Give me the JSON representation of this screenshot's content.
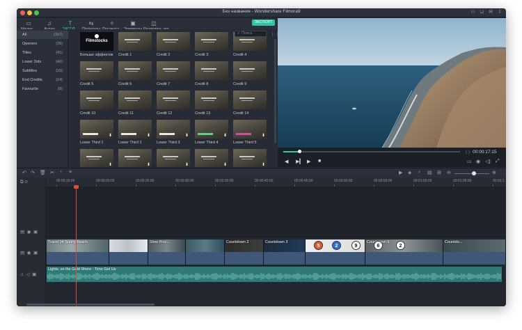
{
  "window": {
    "title": "Без названия - Wondershare Filmora9"
  },
  "title_icons": [
    "person-icon",
    "cart-icon",
    "mail-icon",
    "download-icon"
  ],
  "tabs": [
    {
      "name": "media",
      "label": "Медиа...",
      "icon": "folder-icon",
      "glyph": "▭",
      "active": false
    },
    {
      "name": "audio",
      "label": "Аудио",
      "icon": "music-note-icon",
      "glyph": "♫",
      "active": false
    },
    {
      "name": "titles",
      "label": "ЗАГОЛ...",
      "icon": "text-t-icon",
      "glyph": "T",
      "active": true
    },
    {
      "name": "transitions",
      "label": "Переходы",
      "icon": "transition-icon",
      "glyph": "⇆",
      "active": false
    },
    {
      "name": "effects",
      "label": "Последст...",
      "icon": "effects-icon",
      "glyph": "✧",
      "active": false
    },
    {
      "name": "elements",
      "label": "Элементы",
      "icon": "image-icon",
      "glyph": "▣",
      "active": false
    },
    {
      "name": "split",
      "label": "Разделить экр...",
      "icon": "split-screen-icon",
      "glyph": "◫",
      "active": false
    }
  ],
  "export_label": "ЭКСПОРТ",
  "search": {
    "placeholder": "Поиск"
  },
  "categories": [
    {
      "name": "All",
      "count": "(157)",
      "active": true
    },
    {
      "name": "Openers",
      "count": "(25)",
      "active": false
    },
    {
      "name": "Titles",
      "count": "(41)",
      "active": false
    },
    {
      "name": "Lower 3rds",
      "count": "(42)",
      "active": false
    },
    {
      "name": "Subtitles",
      "count": "(15)",
      "active": false
    },
    {
      "name": "End Credits",
      "count": "(14)",
      "active": false
    },
    {
      "name": "Favourite",
      "count": "(0)",
      "active": false
    }
  ],
  "library_items": [
    {
      "label": "Больше эффектов",
      "type": "brand",
      "brand": "Filmstocks"
    },
    {
      "label": "Credit 1",
      "type": "credit"
    },
    {
      "label": "Credit 2",
      "type": "credit"
    },
    {
      "label": "Credit 3",
      "type": "credit"
    },
    {
      "label": "Credit 4",
      "type": "credit"
    },
    {
      "label": "Credit 5",
      "type": "credit"
    },
    {
      "label": "Credit 6",
      "type": "credit"
    },
    {
      "label": "Credit 7",
      "type": "credit"
    },
    {
      "label": "Credit 8",
      "type": "credit"
    },
    {
      "label": "Credit 9",
      "type": "credit"
    },
    {
      "label": "Credit 10",
      "type": "credit"
    },
    {
      "label": "Credit 11",
      "type": "credit"
    },
    {
      "label": "Credit 12",
      "type": "credit"
    },
    {
      "label": "Credit 13",
      "type": "credit"
    },
    {
      "label": "Credit 14",
      "type": "credit"
    },
    {
      "label": "Lower Third 1",
      "type": "lower"
    },
    {
      "label": "Lower Third 2",
      "type": "lower"
    },
    {
      "label": "Lower Third 3",
      "type": "lower"
    },
    {
      "label": "Lower Third 4",
      "type": "lower"
    },
    {
      "label": "Lower Third 5",
      "type": "lower"
    },
    {
      "label": "",
      "type": "partial"
    },
    {
      "label": "",
      "type": "partial"
    },
    {
      "label": "",
      "type": "partial"
    },
    {
      "label": "",
      "type": "partial"
    },
    {
      "label": "",
      "type": "partial"
    }
  ],
  "player": {
    "timecode": "00:00:17:15",
    "brackets": "{ }",
    "progress": 0.09
  },
  "timeline": {
    "ruler": [
      "00:00:15:00",
      "00:00:20:00",
      "00:00:25:00",
      "00:00:30:00",
      "00:00:35:00",
      "00:00:40:00",
      "00:00:45:00",
      "00:00:50:00",
      "00:00:55:00",
      "00:01:00:00",
      "00:01:05:00",
      "00:01:1"
    ],
    "video_clips": [
      {
        "label": "Travel 04 Sunny Beach",
        "kind": "beach"
      },
      {
        "label": "",
        "kind": "snow"
      },
      {
        "label": "Slow Proc...",
        "kind": "rock"
      },
      {
        "label": "",
        "kind": "sea"
      },
      {
        "label": "Countdown 2",
        "kind": "count2"
      },
      {
        "label": "Countdown 3",
        "kind": "count3"
      },
      {
        "label": "",
        "kind": "count4"
      },
      {
        "label": "Countdown 5",
        "kind": "count5"
      },
      {
        "label": "Countdo...",
        "kind": "count6"
      }
    ],
    "countdown_numbers": [
      "5",
      "2",
      "9",
      "6",
      "2"
    ],
    "audio_label": "Lights, so the Gold Shore - Time Get Us"
  }
}
